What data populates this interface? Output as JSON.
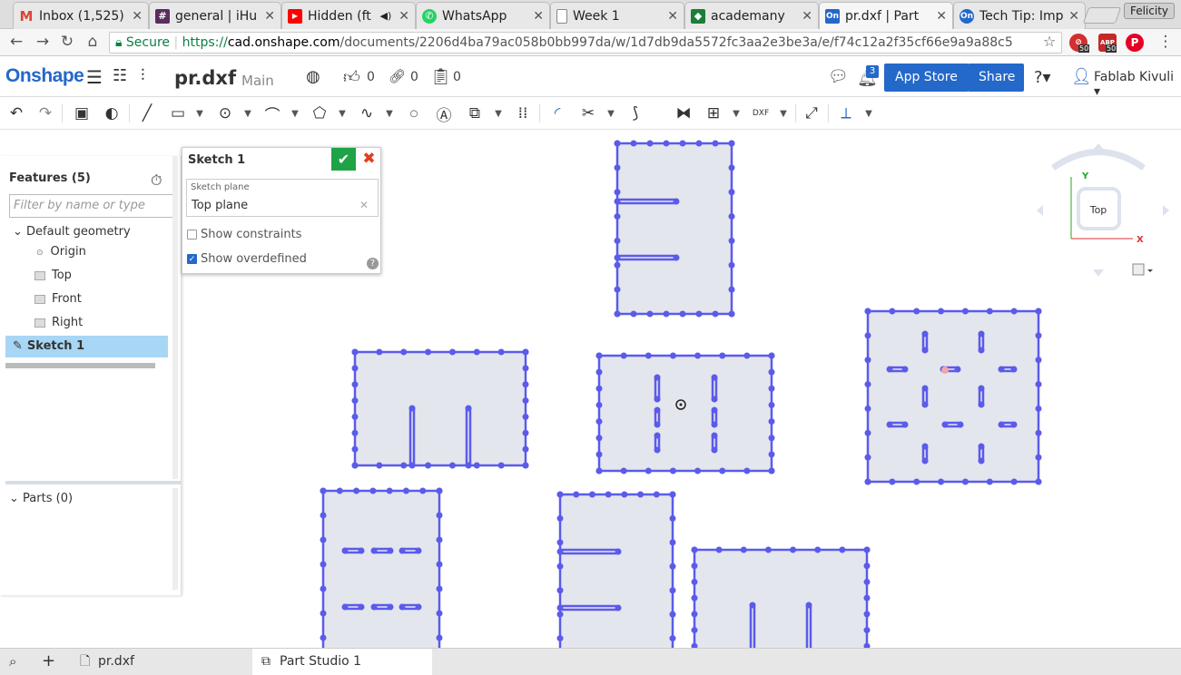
{
  "browser": {
    "tabs": [
      {
        "label": "Inbox (1,525)",
        "icon": "gmail-icon",
        "color": "#db4437",
        "glyph": "M"
      },
      {
        "label": "general | iHu",
        "icon": "slack-icon",
        "color": "#5b2d5c",
        "glyph": "#"
      },
      {
        "label": "Hidden (ft",
        "icon": "youtube-icon",
        "color": "#ff0000",
        "glyph": "▶"
      },
      {
        "label": "WhatsApp",
        "icon": "whatsapp-icon",
        "color": "#25d366",
        "glyph": "✆"
      },
      {
        "label": "Week 1",
        "icon": "document-icon",
        "color": "#888888",
        "glyph": "▯"
      },
      {
        "label": "academany",
        "icon": "academany-icon",
        "color": "#1a7f37",
        "glyph": "◆"
      },
      {
        "label": "pr.dxf | Part",
        "icon": "onshape-icon",
        "color": "#2468ca",
        "glyph": "On"
      },
      {
        "label": "Tech Tip: Imp",
        "icon": "onshape-icon",
        "color": "#2468ca",
        "glyph": "On"
      }
    ],
    "profile": "Felicity",
    "address": {
      "secure": "Secure",
      "proto": "https://",
      "host": "cad.onshape.com",
      "path": "/documents/2206d4ba79ac058b0bb997da/w/1d7db9da5572fc3aa2e3be3a/e/f74c12a2f35cf66e9a9a88c5"
    },
    "ext_counts": [
      "50",
      "50"
    ]
  },
  "app": {
    "logo": "Onshape",
    "doc_title": "pr.dxf",
    "workspace": "Main",
    "likes": "0",
    "links": "0",
    "copies": "0",
    "notifications": "3",
    "app_store": "App Store",
    "share": "Share",
    "user": "Fablab Kivuli"
  },
  "features": {
    "header": "Features (5)",
    "filter_placeholder": "Filter by name or type",
    "items": [
      {
        "label": "Default geometry"
      },
      {
        "label": "Origin"
      },
      {
        "label": "Top"
      },
      {
        "label": "Front"
      },
      {
        "label": "Right"
      },
      {
        "label": "Sketch 1"
      }
    ],
    "parts": "Parts (0)"
  },
  "sketch_dialog": {
    "title": "Sketch 1",
    "plane_label": "Sketch plane",
    "plane_value": "Top plane",
    "show_constraints": "Show constraints",
    "show_overdefined": "Show overdefined",
    "show_constraints_checked": false,
    "show_overdefined_checked": true
  },
  "viewcube": {
    "face": "Top",
    "axis_x": "X",
    "axis_y": "Y"
  },
  "bottom_tabs": [
    {
      "label": "pr.dxf"
    },
    {
      "label": "Part Studio 1"
    }
  ],
  "colors": {
    "accent": "#2468ca",
    "sketch_line": "#5b5bea",
    "sketch_fill": "#e4e6ee",
    "confirm": "#1ea446",
    "cancel": "#e04020"
  }
}
